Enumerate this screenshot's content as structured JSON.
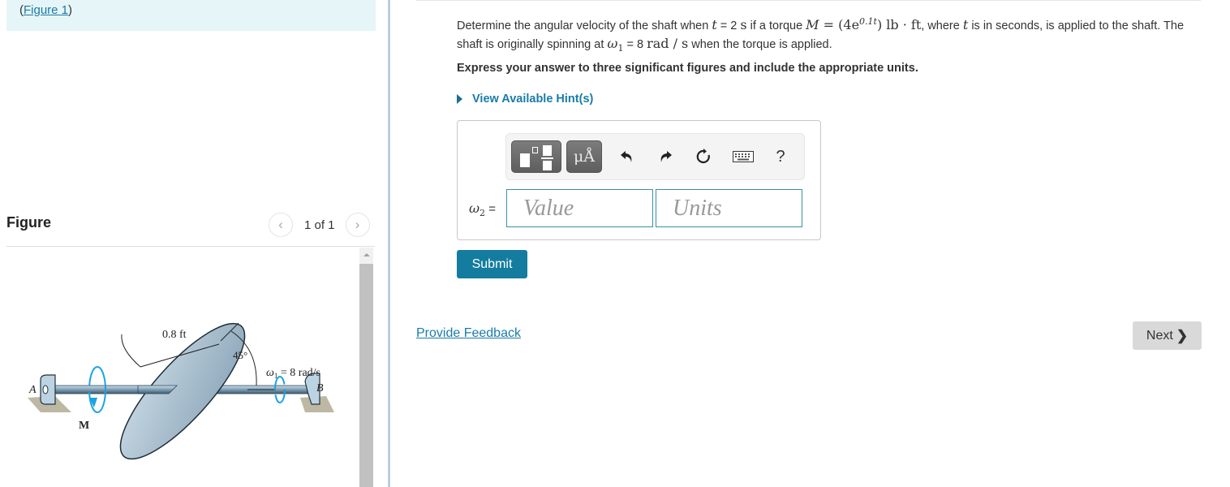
{
  "left_panel": {
    "figure_ref_prefix": "(",
    "figure_ref_link": "Figure 1",
    "figure_ref_suffix": ")",
    "figure_heading": "Figure",
    "pager": {
      "current": 1,
      "total": 1,
      "text": "1 of 1",
      "prev_icon": "chevron-left-icon",
      "next_icon": "chevron-right-icon"
    },
    "figure": {
      "labels": {
        "radius": "0.8 ft",
        "angle": "45°",
        "omega1": "ω",
        "omega1_sub": "1",
        "omega1_rest": " = 8 rad/s",
        "point_a": "A",
        "point_b": "B",
        "moment": "M"
      }
    }
  },
  "problem": {
    "text_1": "Determine the angular velocity of the shaft when ",
    "t_var": "t",
    "text_2": " = 2 ",
    "s_unit": "s",
    "text_3": " if a torque ",
    "M_var": "M",
    "equals": " = (4e",
    "exponent": "0.1t",
    "close": ") ",
    "lb": "lb",
    "dot": " · ",
    "ft": "ft",
    "text_4": ", where ",
    "t_var2": "t",
    "text_5": " is in seconds, is applied to the shaft. The shaft is originally spinning at ",
    "omega": "ω",
    "omega_sub": "1",
    "text_6": " = 8 ",
    "rad_unit": "rad / s",
    "text_7": " when the torque is applied.",
    "instruction": "Express your answer to three significant figures and include the appropriate units.",
    "hint_label": "View Available Hint(s)"
  },
  "answer": {
    "label_var": "ω",
    "label_sub": "2",
    "label_eq": " =",
    "value_placeholder": "Value",
    "units_placeholder": "Units",
    "toolbar": {
      "templates_icon": "templates-icon",
      "units_label": "μÅ",
      "undo_icon": "undo-icon",
      "redo_icon": "redo-icon",
      "reset_icon": "reset-icon",
      "keyboard_icon": "keyboard-icon",
      "help_label": "?"
    }
  },
  "actions": {
    "submit_label": "Submit",
    "feedback_label": "Provide Feedback",
    "next_label": "Next",
    "next_chevron": "❯"
  },
  "colors": {
    "accent": "#147c9f",
    "link": "#1a7ca7",
    "figure_ref_bg": "#e6f5f7",
    "input_border": "#3a8fa8",
    "next_bg": "#d9d9d9"
  }
}
